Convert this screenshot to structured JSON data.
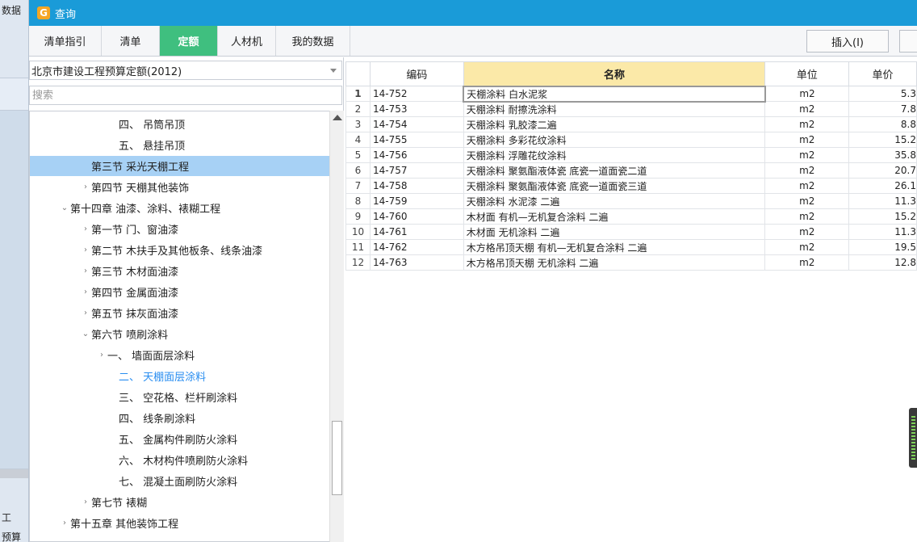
{
  "background_app": {
    "label_top": "数据",
    "label_bottom_1": "工",
    "label_bottom_2": "预算"
  },
  "window": {
    "title": "查询"
  },
  "tabs": [
    {
      "label": "清单指引",
      "active": false
    },
    {
      "label": "清单",
      "active": false
    },
    {
      "label": "定额",
      "active": true
    },
    {
      "label": "人材机",
      "active": false
    },
    {
      "label": "我的数据",
      "active": false
    }
  ],
  "toolbar": {
    "insert_label": "插入(I)"
  },
  "left_panel": {
    "library_select": "北京市建设工程预算定额(2012)",
    "search_placeholder": "搜索"
  },
  "tree": [
    {
      "label": "四、 吊筒吊顶",
      "chevron": ""
    },
    {
      "label": "五、 悬挂吊顶",
      "chevron": ""
    },
    {
      "label": "第三节 采光天棚工程",
      "chevron": "",
      "selected": true
    },
    {
      "label": "第四节 天棚其他装饰",
      "chevron": "›"
    },
    {
      "label": "第十四章 油漆、涂料、裱糊工程",
      "chevron": "⌄"
    },
    {
      "label": "第一节 门、窗油漆",
      "chevron": "›"
    },
    {
      "label": "第二节 木扶手及其他板条、线条油漆",
      "chevron": "›"
    },
    {
      "label": "第三节 木材面油漆",
      "chevron": "›"
    },
    {
      "label": "第四节 金属面油漆",
      "chevron": "›"
    },
    {
      "label": "第五节 抹灰面油漆",
      "chevron": "›"
    },
    {
      "label": "第六节 喷刷涂料",
      "chevron": "⌄"
    },
    {
      "label": "一、 墙面面层涂料",
      "chevron": "›"
    },
    {
      "label": "二、 天棚面层涂料",
      "chevron": "",
      "highlight": true
    },
    {
      "label": "三、 空花格、栏杆刷涂料",
      "chevron": ""
    },
    {
      "label": "四、 线条刷涂料",
      "chevron": ""
    },
    {
      "label": "五、 金属构件刷防火涂料",
      "chevron": ""
    },
    {
      "label": "六、 木材构件喷刷防火涂料",
      "chevron": ""
    },
    {
      "label": "七、 混凝土面刷防火涂料",
      "chevron": ""
    },
    {
      "label": "第七节 裱糊",
      "chevron": "›"
    },
    {
      "label": "第十五章 其他装饰工程",
      "chevron": "›"
    }
  ],
  "grid": {
    "columns": [
      "",
      "编码",
      "名称",
      "单位",
      "单价"
    ],
    "rows": [
      {
        "index": "1",
        "code": "14-752",
        "name": "天棚涂料 白水泥浆",
        "unit": "m2",
        "price": "5.3"
      },
      {
        "index": "2",
        "code": "14-753",
        "name": "天棚涂料 耐擦洗涂料",
        "unit": "m2",
        "price": "7.8"
      },
      {
        "index": "3",
        "code": "14-754",
        "name": "天棚涂料 乳胶漆二遍",
        "unit": "m2",
        "price": "8.8"
      },
      {
        "index": "4",
        "code": "14-755",
        "name": "天棚涂料 多彩花纹涂料",
        "unit": "m2",
        "price": "15.2"
      },
      {
        "index": "5",
        "code": "14-756",
        "name": "天棚涂料 浮雕花纹涂料",
        "unit": "m2",
        "price": "35.8"
      },
      {
        "index": "6",
        "code": "14-757",
        "name": "天棚涂料 聚氨酯液体瓷 底瓷一道面瓷二道",
        "unit": "m2",
        "price": "20.7"
      },
      {
        "index": "7",
        "code": "14-758",
        "name": "天棚涂料 聚氨酯液体瓷 底瓷一道面瓷三道",
        "unit": "m2",
        "price": "26.1"
      },
      {
        "index": "8",
        "code": "14-759",
        "name": "天棚涂料 水泥漆 二遍",
        "unit": "m2",
        "price": "11.3"
      },
      {
        "index": "9",
        "code": "14-760",
        "name": "木材面 有机—无机复合涂料 二遍",
        "unit": "m2",
        "price": "15.2"
      },
      {
        "index": "10",
        "code": "14-761",
        "name": "木材面 无机涂料 二遍",
        "unit": "m2",
        "price": "11.3"
      },
      {
        "index": "11",
        "code": "14-762",
        "name": "木方格吊顶天棚 有机—无机复合涂料 二遍",
        "unit": "m2",
        "price": "19.5"
      },
      {
        "index": "12",
        "code": "14-763",
        "name": "木方格吊顶天棚 无机涂料 二遍",
        "unit": "m2",
        "price": "12.8"
      }
    ]
  },
  "colors": {
    "titlebar": "#1a9bd8",
    "active_tab": "#3fbf7f",
    "name_header": "#fbe9a8",
    "tree_selected": "#a7d1f5",
    "tree_highlight_text": "#2a8ef0"
  }
}
